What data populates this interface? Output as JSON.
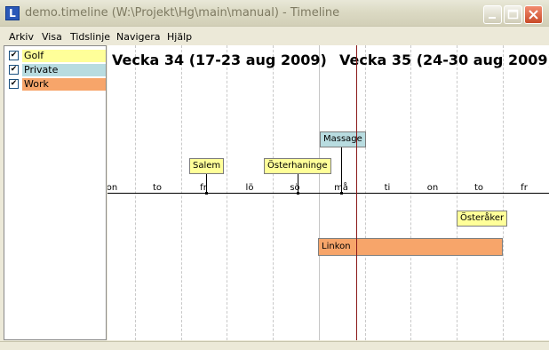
{
  "window": {
    "icon_letter": "L",
    "title": "demo.timeline (W:\\Projekt\\Hg\\main\\manual) - Timeline"
  },
  "menu": [
    {
      "label": "Arkiv"
    },
    {
      "label": "Visa"
    },
    {
      "label": "Tidslinje"
    },
    {
      "label": "Navigera"
    },
    {
      "label": "Hjälp"
    }
  ],
  "categories": [
    {
      "label": "Golf",
      "checked": true,
      "check_glyph": "✔",
      "color": "#ffff99"
    },
    {
      "label": "Private",
      "checked": true,
      "check_glyph": "✔",
      "color": "#b8dce0"
    },
    {
      "label": "Work",
      "checked": true,
      "check_glyph": "✔",
      "color": "#f7a56a"
    }
  ],
  "timeline": {
    "week_labels": [
      "Vecka 34 (17-23 aug 2009)",
      "Vecka 35 (24-30 aug 2009)"
    ],
    "day_labels": [
      "on",
      "to",
      "fr",
      "lö",
      "sö",
      "må",
      "ti",
      "on",
      "to",
      "fr"
    ],
    "events": [
      {
        "label": "Massage",
        "category": "Private"
      },
      {
        "label": "Salem",
        "category": "Golf"
      },
      {
        "label": "Österhaninge",
        "category": "Golf"
      },
      {
        "label": "Österåker",
        "category": "Golf"
      },
      {
        "label": "Linkon",
        "category": "Work"
      }
    ],
    "colors": {
      "now_line": "#8b1a1a",
      "axis": "#000000"
    }
  }
}
